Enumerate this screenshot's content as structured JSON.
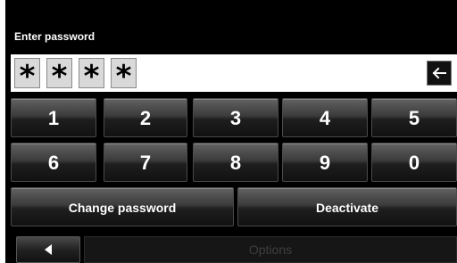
{
  "title": "Enter password",
  "password": {
    "masked_chars": [
      "*",
      "*",
      "*",
      "*"
    ]
  },
  "keypad": {
    "row1": [
      "1",
      "2",
      "3",
      "4",
      "5"
    ],
    "row2": [
      "6",
      "7",
      "8",
      "9",
      "0"
    ]
  },
  "actions": {
    "change_password": "Change password",
    "deactivate": "Deactivate"
  },
  "footer": {
    "options_label": "Options"
  },
  "icons": {
    "backspace": "left-arrow-backspace-icon",
    "back": "triangle-left-back-icon"
  },
  "colors": {
    "background": "#000000",
    "text": "#ffffff",
    "disabled_text": "#3e3e3e"
  }
}
